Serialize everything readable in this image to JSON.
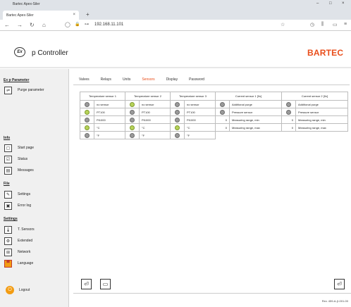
{
  "browser": {
    "window_title": "Bartec Apex-Siler",
    "tab_title": "Bartec Apex-Siler",
    "url": "192.168.11.101",
    "new_tab": "+",
    "close": "×",
    "minimize": "–",
    "maximize": "□",
    "win_close": "×"
  },
  "app": {
    "logo_text": "Ex",
    "title": "p Controller",
    "brand": "BARTEC"
  },
  "sidebar": {
    "sections": [
      {
        "heading": "Ex p Parameter",
        "items": [
          {
            "label": "Purge parameter",
            "icon": "purge-icon"
          }
        ]
      },
      {
        "heading": "Info",
        "items": [
          {
            "label": "Start page",
            "icon": "home-icon"
          },
          {
            "label": "Status",
            "icon": "status-icon"
          },
          {
            "label": "Messages",
            "icon": "messages-icon"
          }
        ]
      },
      {
        "heading": "File",
        "items": [
          {
            "label": "Settings",
            "icon": "settings-icon"
          },
          {
            "label": "Error log",
            "icon": "errorlog-icon"
          }
        ]
      },
      {
        "heading": "Settings",
        "items": [
          {
            "label": "T. Sensors",
            "icon": "thermometer-icon"
          },
          {
            "label": "Extended",
            "icon": "extended-icon"
          },
          {
            "label": "Network",
            "icon": "network-icon"
          },
          {
            "label": "Language",
            "icon": "flag-icon"
          }
        ]
      }
    ],
    "logout": "Logout"
  },
  "main": {
    "tabs": [
      "Valves",
      "Relays",
      "Units",
      "Sensors",
      "Display",
      "Password"
    ],
    "active_tab": "Sensors",
    "table_headers": [
      "Temperature sensor 1",
      "Temperature sensor 2",
      "Temperature sensor 3",
      "Current sensor 1 [0x]",
      "Current sensor 2 [0x]"
    ],
    "temp_rows": [
      {
        "t1": "no sensor",
        "t2": "no sensor",
        "t3": "no sensor",
        "t1led": "gray",
        "t2led": "green",
        "t3led": "gray"
      },
      {
        "t1": "PT100",
        "t2": "PT100",
        "t3": "PT100",
        "t1led": "green",
        "t2led": "gray",
        "t3led": "gray"
      },
      {
        "t1": "Pt1000",
        "t2": "Pt1000",
        "t3": "Pt1000",
        "t1led": "gray",
        "t2led": "gray",
        "t3led": "gray"
      },
      {
        "t1": "°C",
        "t2": "°C",
        "t3": "°C",
        "t1led": "green",
        "t2led": "green",
        "t3led": "green"
      },
      {
        "t1": "°F",
        "t2": "°F",
        "t3": "°F",
        "t1led": "gray",
        "t2led": "gray",
        "t3led": "gray"
      }
    ],
    "current_rows": [
      {
        "c1val": "",
        "c1": "Additional purge",
        "c2val": "",
        "c2": "Additional purge"
      },
      {
        "c1val": "",
        "c1": "Pressure sensor",
        "c2val": "",
        "c2": "Pressure sensor"
      },
      {
        "c1val": "0",
        "c1": "Measuring range, min",
        "c2val": "0",
        "c2": "Measuring range, min"
      },
      {
        "c1val": "0",
        "c1": "Measuring range, max",
        "c2val": "0",
        "c2": "Measuring range, max"
      }
    ]
  },
  "footer": {
    "revision": "Rev. 459-A-(I-001-00"
  }
}
